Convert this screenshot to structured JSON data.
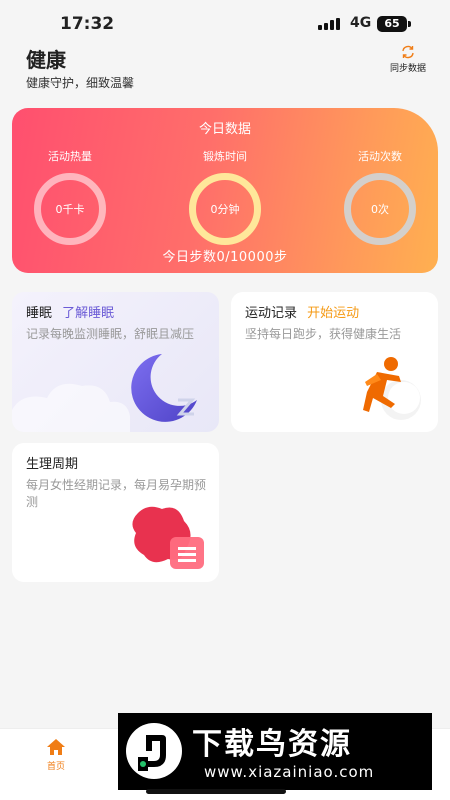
{
  "status_bar": {
    "time": "17:32",
    "network": "4G",
    "battery": "65"
  },
  "header": {
    "title": "健康",
    "subtitle": "健康守护，细致温馨",
    "sync_label": "同步数据"
  },
  "today": {
    "title": "今日数据",
    "metrics": [
      {
        "label": "活动热量",
        "value": "0千卡"
      },
      {
        "label": "锻炼时间",
        "value": "0分钟"
      },
      {
        "label": "活动次数",
        "value": "0次"
      }
    ],
    "steps_text": "今日步数0/10000步"
  },
  "cards": {
    "sleep": {
      "title": "睡眠",
      "link": "了解睡眠",
      "desc": "记录每晚监测睡眠，舒眠且减压"
    },
    "sport": {
      "title": "运动记录",
      "link": "开始运动",
      "desc": "坚持每日跑步，获得健康生活"
    },
    "cycle": {
      "title": "生理周期",
      "desc": "每月女性经期记录，每月易孕期预测"
    }
  },
  "nav": {
    "home_label": "首页"
  },
  "watermark": {
    "cn": "下载鸟资源",
    "url": "www.xiazainiao.com"
  },
  "colors": {
    "accent_orange": "#f07d16",
    "purple_link": "#6b5bd6",
    "orange_link": "#f59a14"
  }
}
